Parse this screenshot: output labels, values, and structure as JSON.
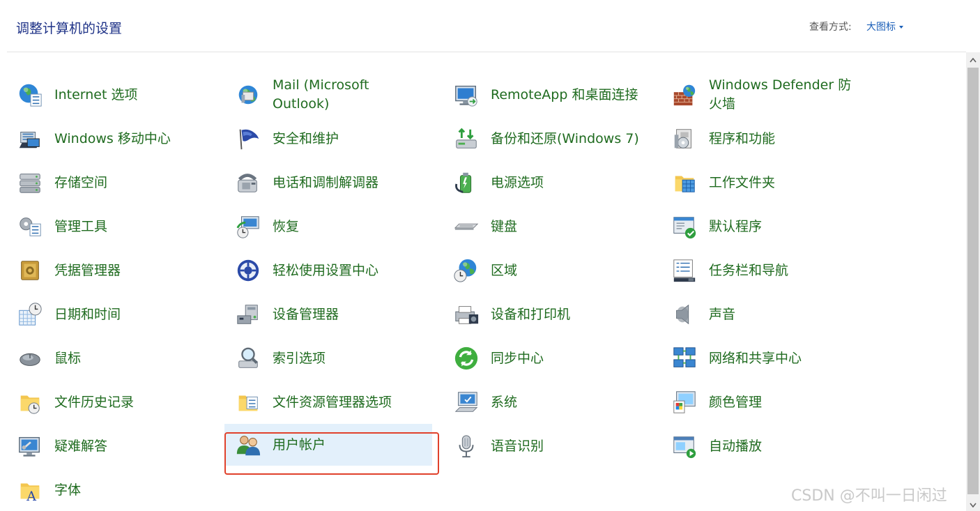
{
  "header": {
    "title": "调整计算机的设置",
    "view_by_label": "查看方式:",
    "view_by_value": "大图标"
  },
  "items": [
    {
      "label": "Internet 选项",
      "icon": "internet-options-icon"
    },
    {
      "label": "Mail (Microsoft Outlook)",
      "icon": "mail-icon"
    },
    {
      "label": "RemoteApp 和桌面连接",
      "icon": "remoteapp-icon"
    },
    {
      "label": "Windows Defender 防火墙",
      "icon": "firewall-icon"
    },
    {
      "label": "Windows 移动中心",
      "icon": "mobility-center-icon"
    },
    {
      "label": "安全和维护",
      "icon": "security-flag-icon"
    },
    {
      "label": "备份和还原(Windows 7)",
      "icon": "backup-icon"
    },
    {
      "label": "程序和功能",
      "icon": "programs-icon"
    },
    {
      "label": "存储空间",
      "icon": "storage-icon"
    },
    {
      "label": "电话和调制解调器",
      "icon": "phone-icon"
    },
    {
      "label": "电源选项",
      "icon": "power-icon"
    },
    {
      "label": "工作文件夹",
      "icon": "work-folders-icon"
    },
    {
      "label": "管理工具",
      "icon": "admin-tools-icon"
    },
    {
      "label": "恢复",
      "icon": "recovery-icon"
    },
    {
      "label": "键盘",
      "icon": "keyboard-icon"
    },
    {
      "label": "默认程序",
      "icon": "default-programs-icon"
    },
    {
      "label": "凭据管理器",
      "icon": "credential-icon"
    },
    {
      "label": "轻松使用设置中心",
      "icon": "ease-of-access-icon"
    },
    {
      "label": "区域",
      "icon": "region-icon"
    },
    {
      "label": "任务栏和导航",
      "icon": "taskbar-icon"
    },
    {
      "label": "日期和时间",
      "icon": "datetime-icon"
    },
    {
      "label": "设备管理器",
      "icon": "device-manager-icon"
    },
    {
      "label": "设备和打印机",
      "icon": "printer-icon"
    },
    {
      "label": "声音",
      "icon": "sound-icon"
    },
    {
      "label": "鼠标",
      "icon": "mouse-icon"
    },
    {
      "label": "索引选项",
      "icon": "indexing-icon"
    },
    {
      "label": "同步中心",
      "icon": "sync-icon"
    },
    {
      "label": "网络和共享中心",
      "icon": "network-icon"
    },
    {
      "label": "文件历史记录",
      "icon": "file-history-icon"
    },
    {
      "label": "文件资源管理器选项",
      "icon": "explorer-options-icon"
    },
    {
      "label": "系统",
      "icon": "system-icon"
    },
    {
      "label": "颜色管理",
      "icon": "color-management-icon"
    },
    {
      "label": "疑难解答",
      "icon": "troubleshoot-icon"
    },
    {
      "label": "用户帐户",
      "icon": "user-accounts-icon",
      "selected": true
    },
    {
      "label": "语音识别",
      "icon": "microphone-icon"
    },
    {
      "label": "自动播放",
      "icon": "autoplay-icon"
    },
    {
      "label": "字体",
      "icon": "fonts-icon"
    }
  ],
  "watermark": "CSDN @不叫一日闲过",
  "colors": {
    "title": "#1e3287",
    "item_text": "#1f6b1f",
    "link": "#1b5fb8",
    "selection_bg": "#e3f0fb",
    "selection_border": "#e0412b"
  }
}
